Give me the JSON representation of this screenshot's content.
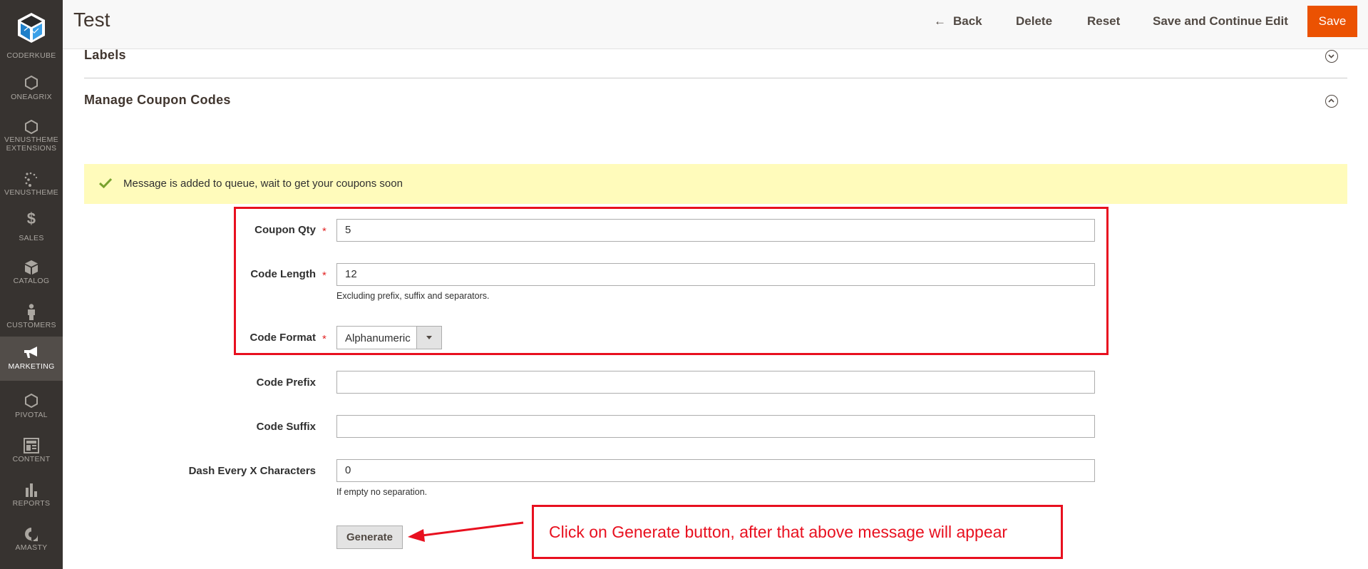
{
  "sidebar": {
    "logo_label": "CODERKUBE",
    "items": [
      {
        "label": "ONEAGRIX",
        "icon": "hexagon-icon"
      },
      {
        "label_line1": "VENUSTHEME",
        "label_line2": "EXTENSIONS",
        "icon": "hexagon-icon"
      },
      {
        "label": "VENUSTHEME",
        "icon": "sparkle-icon"
      },
      {
        "label": "SALES",
        "icon": "dollar-icon"
      },
      {
        "label": "CATALOG",
        "icon": "box-icon"
      },
      {
        "label": "CUSTOMERS",
        "icon": "person-icon"
      },
      {
        "label": "MARKETING",
        "icon": "megaphone-icon",
        "active": true
      },
      {
        "label": "PIVOTAL",
        "icon": "hexagon-icon"
      },
      {
        "label": "CONTENT",
        "icon": "layout-icon"
      },
      {
        "label": "REPORTS",
        "icon": "bar-chart-icon"
      },
      {
        "label": "AMASTY",
        "icon": "amasty-icon"
      }
    ]
  },
  "header": {
    "title": "Test",
    "back_label": "Back",
    "delete_label": "Delete",
    "reset_label": "Reset",
    "save_continue_label": "Save and Continue Edit",
    "save_label": "Save"
  },
  "sections": {
    "labels_title": "Labels",
    "manage_title": "Manage Coupon Codes"
  },
  "message": {
    "text": "Message is added to queue, wait to get your coupons soon"
  },
  "form": {
    "coupon_qty": {
      "label": "Coupon Qty",
      "value": "5",
      "required": true
    },
    "code_length": {
      "label": "Code Length",
      "value": "12",
      "note": "Excluding prefix, suffix and separators.",
      "required": true
    },
    "code_format": {
      "label": "Code Format",
      "value": "Alphanumeric",
      "required": true
    },
    "code_prefix": {
      "label": "Code Prefix",
      "value": ""
    },
    "code_suffix": {
      "label": "Code Suffix",
      "value": ""
    },
    "dash_every": {
      "label": "Dash Every X Characters",
      "value": "0",
      "note": "If empty no separation."
    },
    "generate_label": "Generate"
  },
  "annotation": {
    "text": "Click on Generate button, after that above message will appear"
  },
  "colors": {
    "sidebar_bg": "#373330",
    "accent_save": "#eb5202",
    "message_bg": "#fffbbb",
    "annotation_red": "#e8101f",
    "required_star": "#e22626"
  }
}
